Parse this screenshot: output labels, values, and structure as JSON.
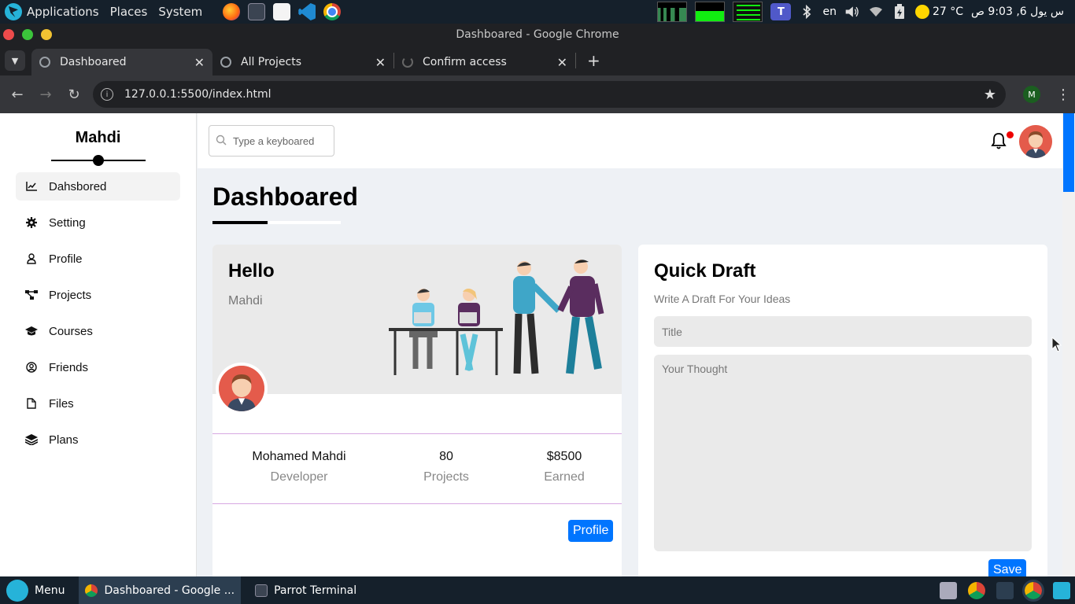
{
  "os_panel": {
    "menus": [
      "Applications",
      "Places",
      "System"
    ],
    "lang": "en",
    "temperature": "27 °C",
    "clock": "س يول 6, 9:03 ص"
  },
  "chrome": {
    "window_title": "Dashboared - Google Chrome",
    "tabs": [
      {
        "title": "Dashboared"
      },
      {
        "title": "All Projects"
      },
      {
        "title": "Confirm access"
      }
    ],
    "new_tab": "+",
    "url": "127.0.0.1:5500/index.html",
    "profile_initial": "M"
  },
  "sidebar": {
    "brand": "Mahdi",
    "items": [
      {
        "label": "Dahsbored",
        "icon": "chart-line-icon"
      },
      {
        "label": "Setting",
        "icon": "gear-icon"
      },
      {
        "label": "Profile",
        "icon": "user-icon"
      },
      {
        "label": "Projects",
        "icon": "diagram-project-icon"
      },
      {
        "label": "Courses",
        "icon": "graduation-cap-icon"
      },
      {
        "label": "Friends",
        "icon": "circle-user-icon"
      },
      {
        "label": "Files",
        "icon": "file-icon"
      },
      {
        "label": "Plans",
        "icon": "layer-group-icon"
      }
    ]
  },
  "header": {
    "search_placeholder": "Type a keyboared"
  },
  "main": {
    "title": "Dashboared",
    "hello_card": {
      "heading": "Hello",
      "name": "Mahdi",
      "stats": [
        {
          "value": "Mohamed Mahdi",
          "label": "Developer"
        },
        {
          "value": "80",
          "label": "Projects"
        },
        {
          "value": "$8500",
          "label": "Earned"
        }
      ],
      "profile_button": "Profile"
    },
    "draft_card": {
      "heading": "Quick Draft",
      "subtitle": "Write A Draft For Your Ideas",
      "title_placeholder": "Title",
      "thought_placeholder": "Your Thought",
      "save_button": "Save"
    }
  },
  "taskbar": {
    "menu_label": "Menu",
    "tasks": [
      {
        "label": "Dashboared - Google ..."
      },
      {
        "label": "Parrot Terminal"
      }
    ]
  },
  "colors": {
    "accent": "#0075ff",
    "page_bg": "#eef1f5",
    "notification": "#e00000",
    "avatar": "#e45b4b"
  }
}
